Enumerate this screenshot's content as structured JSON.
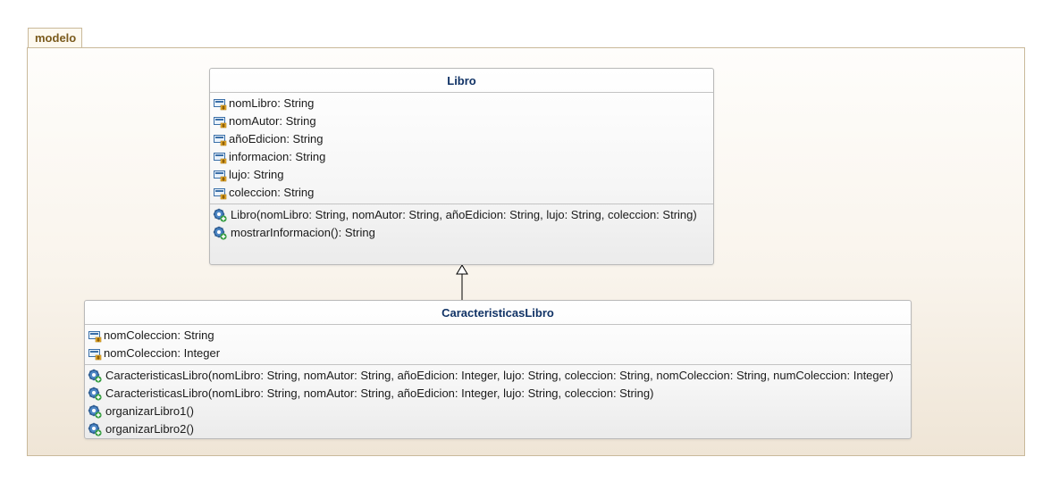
{
  "package": {
    "name": "modelo"
  },
  "classes": {
    "libro": {
      "name": "Libro",
      "attributes": [
        "nomLibro: String",
        "nomAutor: String",
        "añoEdicion: String",
        "informacion: String",
        "lujo: String",
        "coleccion: String"
      ],
      "operations": [
        "Libro(nomLibro: String, nomAutor: String, añoEdicion: String, lujo: String, coleccion: String)",
        "mostrarInformacion(): String"
      ]
    },
    "caracteristicas": {
      "name": "CaracteristicasLibro",
      "attributes": [
        "nomColeccion: String",
        "nomColeccion: Integer"
      ],
      "operations": [
        "CaracteristicasLibro(nomLibro: String, nomAutor: String, añoEdicion: Integer, lujo: String, coleccion: String, nomColeccion: String, numColeccion: Integer)",
        "CaracteristicasLibro(nomLibro: String, nomAutor: String, añoEdicion: Integer, lujo: String, coleccion: String)",
        "organizarLibro1()",
        "organizarLibro2()"
      ]
    }
  },
  "relations": [
    {
      "type": "generalization",
      "from": "CaracteristicasLibro",
      "to": "Libro"
    }
  ],
  "icons": {
    "attribute": "field-icon",
    "operation": "method-icon"
  },
  "colors": {
    "class_name": "#113366",
    "package_label": "#7a5a1c"
  }
}
